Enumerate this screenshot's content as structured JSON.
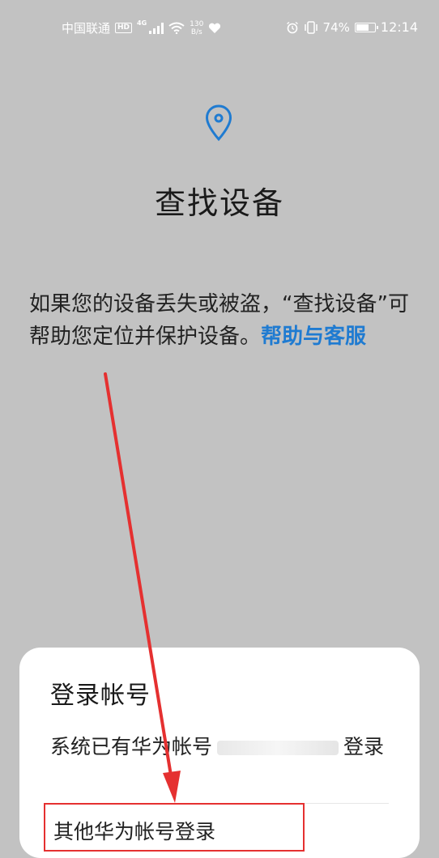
{
  "status_bar": {
    "carrier": "中国联通",
    "hd": "HD",
    "network_type": "4G",
    "net_speed_value": "130",
    "net_speed_unit": "B/s",
    "battery_text": "74%",
    "battery_level": 0.74,
    "time": "12:14",
    "icons": [
      "signal-icon",
      "wifi-icon",
      "heart-icon",
      "alarm-icon",
      "vibrate-icon",
      "battery-icon"
    ]
  },
  "page": {
    "title": "查找设备",
    "description": "如果您的设备丢失或被盗，“查找设备”可帮助您定位并保护设备。",
    "help_link": "帮助与客服",
    "icon": "location-pin-icon"
  },
  "login_sheet": {
    "title": "登录帐号",
    "system_login_prefix": "系统已有华为帐号",
    "system_login_suffix": "登录",
    "other_login": "其他华为帐号登录"
  },
  "colors": {
    "accent": "#1f7bd1",
    "background": "#c2c2c2",
    "annotation": "#e53030"
  }
}
